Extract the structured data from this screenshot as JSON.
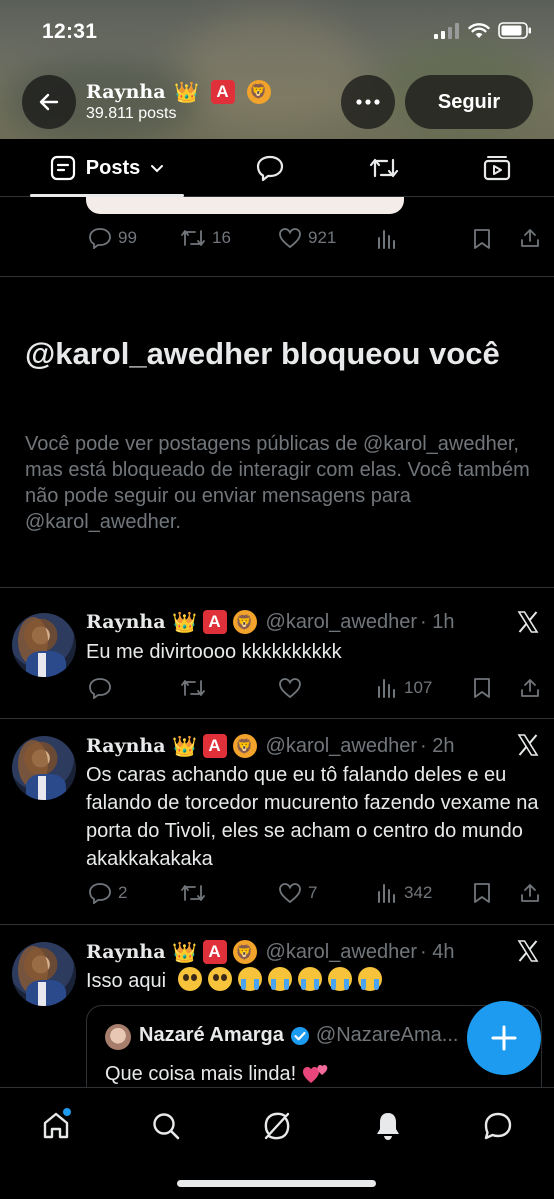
{
  "status_bar": {
    "time": "12:31"
  },
  "header": {
    "name": "Raynha",
    "posts_count": "39.811 posts",
    "follow_label": "Seguir"
  },
  "tabs": [
    {
      "label": "Posts",
      "icon": "posts-icon",
      "selected": true
    },
    {
      "icon": "replies-icon"
    },
    {
      "icon": "retweet-icon"
    },
    {
      "icon": "media-icon"
    }
  ],
  "previous_post_actions": {
    "replies": "99",
    "reposts": "16",
    "likes": "921"
  },
  "blocked_notice": {
    "title": "@karol_awedher bloqueou você",
    "text": "Você pode ver postagens públicas de @karol_awedher, mas está bloqueado de interagir com elas. Você também não pode seguir ou enviar mensagens para @karol_awedher."
  },
  "tweets": [
    {
      "name": "Raynha",
      "handle": "@karol_awedher",
      "time": "· 1h",
      "text": "Eu me divirtoooo kkkkkkkkkk",
      "replies": "",
      "reposts": "",
      "likes": "",
      "views": "107"
    },
    {
      "name": "Raynha",
      "handle": "@karol_awedher",
      "time": "· 2h",
      "text": "Os caras achando que eu tô falando deles e eu falando de torcedor mucurento fazendo vexame na porta do Tivoli, eles se acham o centro do mundo akakkakakaka",
      "replies": "2",
      "reposts": "",
      "likes": "7",
      "views": "342"
    },
    {
      "name": "Raynha",
      "handle": "@karol_awedher",
      "time": "· 4h",
      "text": "Isso aqui",
      "quote": {
        "name": "Nazaré Amarga",
        "handle": "@NazareAma...",
        "text": "Que coisa mais linda!"
      }
    }
  ],
  "colors": {
    "accent": "#1d9bf0",
    "muted": "#71767b",
    "border": "#2f3336"
  }
}
